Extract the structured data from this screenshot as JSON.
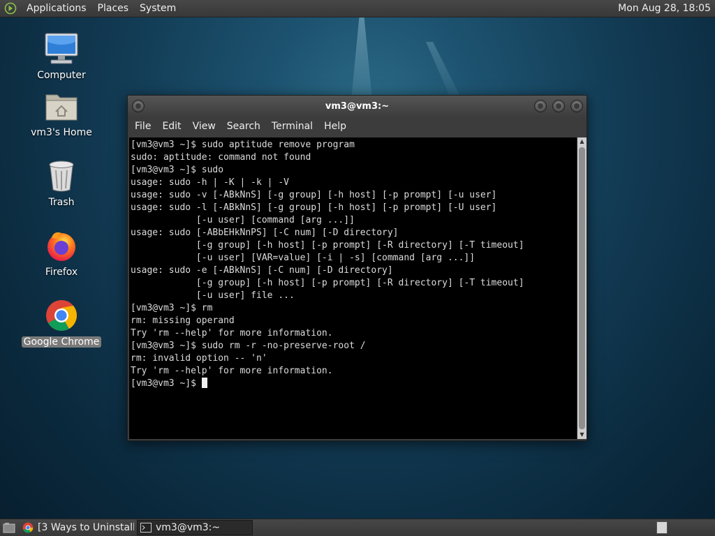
{
  "top_panel": {
    "menus": [
      "Applications",
      "Places",
      "System"
    ],
    "clock": "Mon Aug 28, 18:05"
  },
  "desktop_icons": [
    {
      "label": "Computer",
      "icon": "computer-icon"
    },
    {
      "label": "vm3's Home",
      "icon": "home-folder-icon"
    },
    {
      "label": "Trash",
      "icon": "trash-icon"
    },
    {
      "label": "Firefox",
      "icon": "firefox-icon"
    },
    {
      "label": "Google Chrome",
      "icon": "chrome-icon",
      "selected": true
    }
  ],
  "terminal": {
    "title": "vm3@vm3:~",
    "menu": [
      "File",
      "Edit",
      "View",
      "Search",
      "Terminal",
      "Help"
    ],
    "lines": [
      "[vm3@vm3 ~]$ sudo aptitude remove program",
      "sudo: aptitude: command not found",
      "[vm3@vm3 ~]$ sudo",
      "usage: sudo -h | -K | -k | -V",
      "usage: sudo -v [-ABkNnS] [-g group] [-h host] [-p prompt] [-u user]",
      "usage: sudo -l [-ABkNnS] [-g group] [-h host] [-p prompt] [-U user]",
      "            [-u user] [command [arg ...]]",
      "usage: sudo [-ABbEHkNnPS] [-C num] [-D directory]",
      "            [-g group] [-h host] [-p prompt] [-R directory] [-T timeout]",
      "            [-u user] [VAR=value] [-i | -s] [command [arg ...]]",
      "usage: sudo -e [-ABkNnS] [-C num] [-D directory]",
      "            [-g group] [-h host] [-p prompt] [-R directory] [-T timeout]",
      "            [-u user] file ...",
      "[vm3@vm3 ~]$ rm",
      "rm: missing operand",
      "Try 'rm --help' for more information.",
      "[vm3@vm3 ~]$ sudo rm -r -no-preserve-root /",
      "rm: invalid option -- 'n'",
      "Try 'rm --help' for more information."
    ],
    "prompt": "[vm3@vm3 ~]$ "
  },
  "taskbar": {
    "items": [
      {
        "label": "[3 Ways to Uninstall...",
        "icon": "chrome-icon",
        "active": false
      },
      {
        "label": "vm3@vm3:~",
        "icon": "terminal-icon",
        "active": true
      }
    ]
  },
  "colors": {
    "panel": "#3e3e3e",
    "terminal_bg": "#000000",
    "terminal_fg": "#dcdcdc",
    "desktop": "#123b54"
  }
}
